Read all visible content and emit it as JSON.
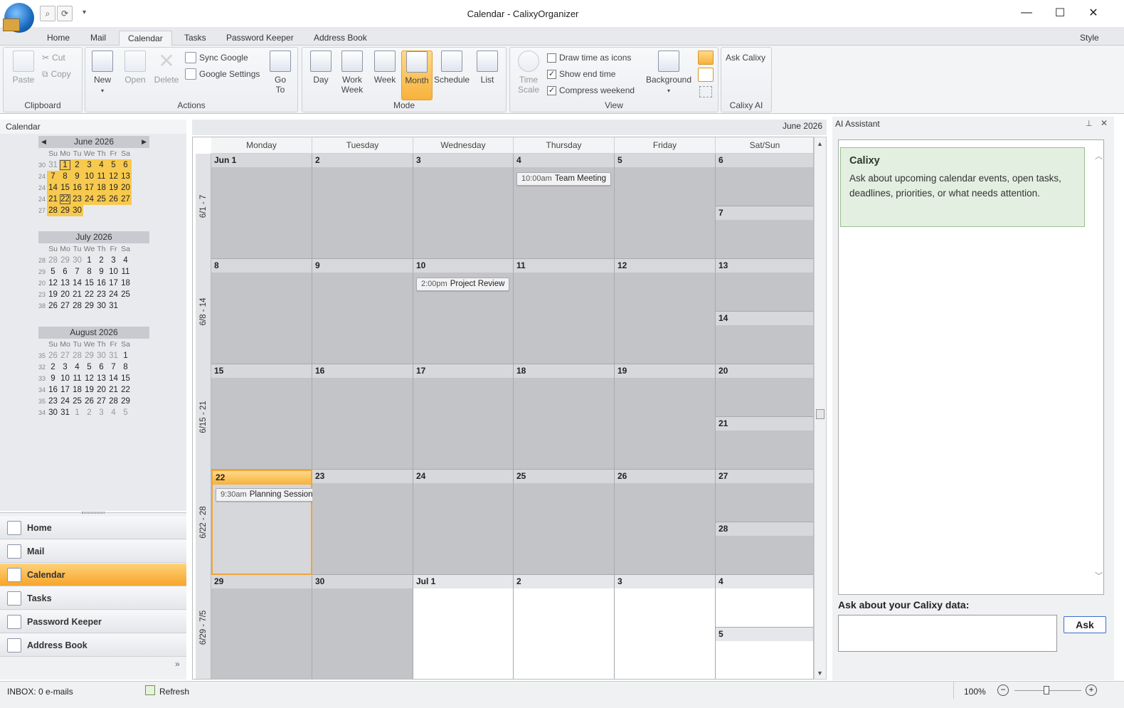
{
  "window": {
    "title": "Calendar - CalixyOrganizer",
    "minimize": "—",
    "maximize": "☐",
    "close": "✕",
    "qat_dropdown": "▾"
  },
  "ribbon_tabs": [
    "Home",
    "Mail",
    "Calendar",
    "Tasks",
    "Password Keeper",
    "Address Book"
  ],
  "ribbon_style": "Style",
  "ribbon": {
    "clipboard": {
      "label": "Clipboard",
      "paste": "Paste",
      "cut": "Cut",
      "copy": "Copy"
    },
    "actions": {
      "label": "Actions",
      "new": "New",
      "open": "Open",
      "delete": "Delete",
      "sync_google": "Sync Google",
      "google_settings": "Google Settings",
      "go_to": "Go To"
    },
    "mode": {
      "label": "Mode",
      "day": "Day",
      "work_week": "Work Week",
      "week": "Week",
      "month": "Month",
      "schedule": "Schedule",
      "list": "List"
    },
    "view": {
      "label": "View",
      "time_scale": "Time Scale",
      "draw_time": "Draw time as icons",
      "show_end": "Show end time",
      "compress": "Compress weekend",
      "background": "Background",
      "draw_time_checked": false,
      "show_end_checked": true,
      "compress_checked": true
    },
    "ai": {
      "label": "Calixy AI",
      "ask": "Ask Calixy"
    }
  },
  "left": {
    "header": "Calendar",
    "june": {
      "title": "June 2026"
    },
    "july": {
      "title": "July 2026"
    },
    "august": {
      "title": "August 2026"
    },
    "dow": [
      "Su",
      "Mo",
      "Tu",
      "We",
      "Th",
      "Fr",
      "Sa"
    ]
  },
  "nav": [
    "Home",
    "Mail",
    "Calendar",
    "Tasks",
    "Password Keeper",
    "Address Book"
  ],
  "nav_more": "»",
  "status": {
    "inbox": "INBOX: 0 e-mails",
    "refresh": "Refresh",
    "zoom": "100%"
  },
  "main": {
    "month_label": "June 2026",
    "day_headers": [
      "Monday",
      "Tuesday",
      "Wednesday",
      "Thursday",
      "Friday",
      "Sat/Sun"
    ],
    "week_labels": [
      "6/1 - 7",
      "6/8 - 14",
      "6/15 - 21",
      "6/22 - 28",
      "6/29 - 7/5"
    ],
    "weeks": [
      {
        "days": [
          "Jun 1",
          "2",
          "3",
          "4",
          "5"
        ],
        "sat": "6",
        "sun": "7"
      },
      {
        "days": [
          "8",
          "9",
          "10",
          "11",
          "12"
        ],
        "sat": "13",
        "sun": "14"
      },
      {
        "days": [
          "15",
          "16",
          "17",
          "18",
          "19"
        ],
        "sat": "20",
        "sun": "21"
      },
      {
        "days": [
          "22",
          "23",
          "24",
          "25",
          "26"
        ],
        "sat": "27",
        "sun": "28"
      },
      {
        "days": [
          "29",
          "30",
          "Jul 1",
          "2",
          "3"
        ],
        "sat": "4",
        "sun": "5"
      }
    ],
    "events": [
      {
        "time": "10:00am",
        "title": "Team Meeting"
      },
      {
        "time": "2:00pm",
        "title": "Project Review"
      },
      {
        "time": "9:30am",
        "title": "Planning Session"
      }
    ]
  },
  "ai": {
    "title": "AI Assistant",
    "pin": "📌",
    "close": "✕",
    "bubble_title": "Calixy",
    "bubble_text": "Ask about upcoming calendar events, open tasks, deadlines, priorities, or what needs attention.",
    "prompt_label": "Ask about your Calixy data:",
    "input_value": "",
    "ask_button": "Ask"
  }
}
